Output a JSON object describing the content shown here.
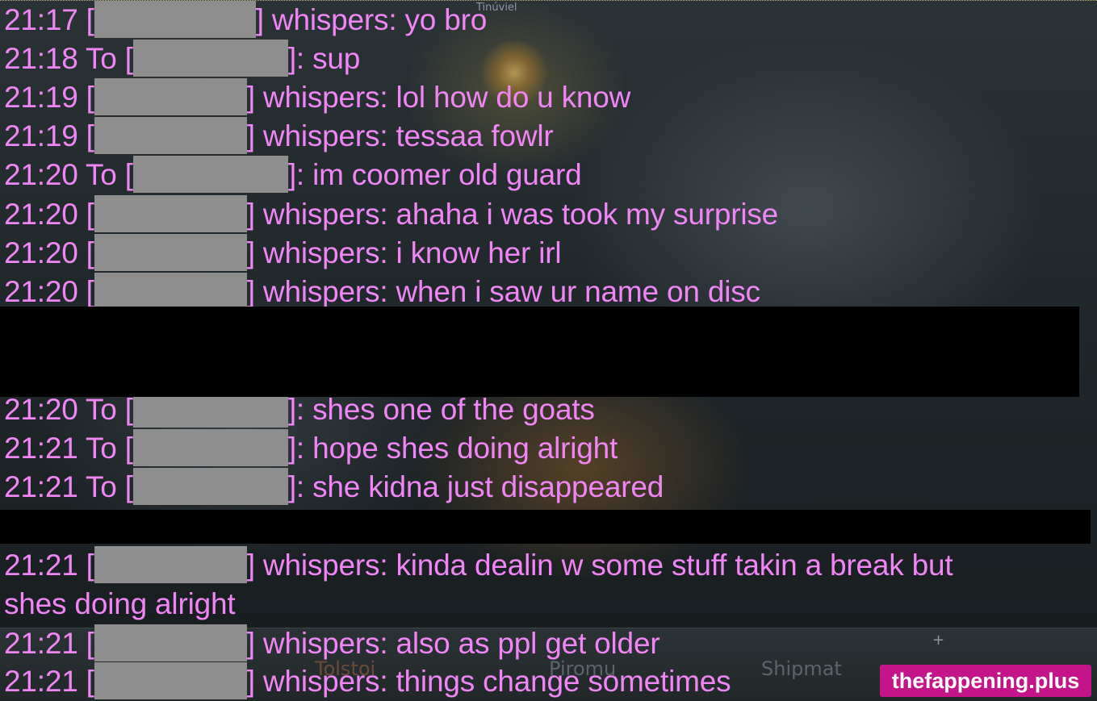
{
  "game": {
    "nameplate": "Tinúviel",
    "bottom_tabs": [
      "Tolstoi",
      "Piromu",
      "Shipmat"
    ],
    "plus_icon": "plus-icon"
  },
  "chat": {
    "color": "#ef86f4",
    "redaction_color": "#8e8e8e",
    "lines": [
      {
        "time": "21:17",
        "prefix": " [",
        "suffix": "] whispers: yo bro"
      },
      {
        "time": "21:18",
        "prefix": " To [",
        "suffix": "]: sup"
      },
      {
        "time": "21:19",
        "prefix": " [",
        "suffix": "] whispers: lol how do u know"
      },
      {
        "time": "21:19",
        "prefix": " [",
        "suffix": "] whispers: tessaa fowlr"
      },
      {
        "time": "21:20",
        "prefix": " To [",
        "suffix": "]: im coomer old guard"
      },
      {
        "time": "21:20",
        "prefix": " [",
        "suffix": "] whispers: ahaha i was took my surprise"
      },
      {
        "time": "21:20",
        "prefix": " [",
        "suffix": "] whispers: i know her irl"
      },
      {
        "time": "21:20",
        "prefix": " [",
        "suffix": "] whispers: when i saw ur name on disc"
      },
      {
        "time": "21:20",
        "prefix": " To [",
        "suffix": "]: shes one of the goats"
      },
      {
        "time": "21:21",
        "prefix": " To [",
        "suffix": "]: hope shes doing alright"
      },
      {
        "time": "21:21",
        "prefix": " To [",
        "suffix": "]: she kidna just disappeared"
      },
      {
        "time": "21:21",
        "prefix": " [",
        "suffix": "] whispers: kinda dealin w some stuff takin a break but"
      },
      {
        "time": "",
        "prefix": "",
        "suffix": "shes doing alright"
      },
      {
        "time": "21:21",
        "prefix": " [",
        "suffix": "] whispers: also as ppl get older"
      },
      {
        "time": "21:21",
        "prefix": " [",
        "suffix": "] whispers: things change sometimes"
      }
    ]
  },
  "watermark": {
    "text": "thefappening.plus",
    "color": "#c4148a"
  }
}
